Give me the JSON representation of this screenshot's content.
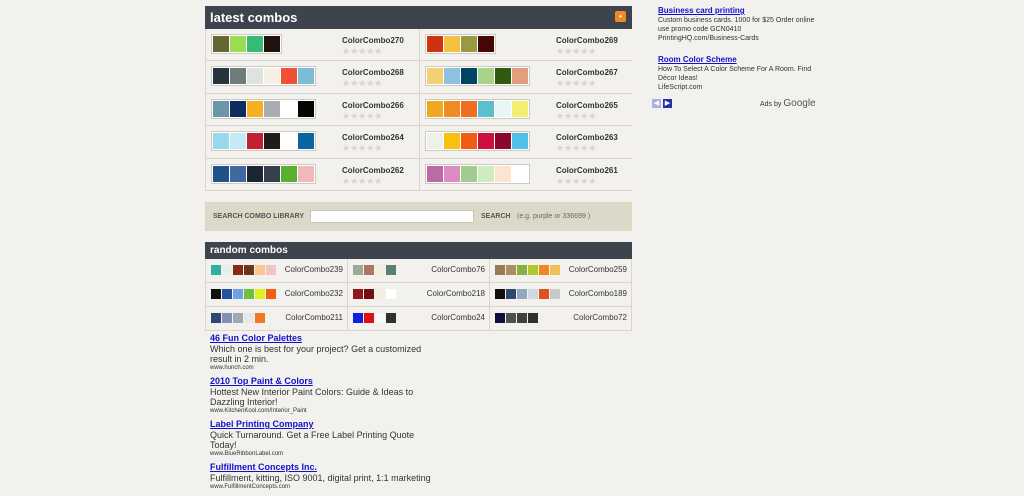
{
  "latest": {
    "title": "latest combos",
    "combos": [
      {
        "name": "ColorCombo270",
        "colors": [
          "#666633",
          "#99dd55",
          "#33bb77",
          "#221111"
        ]
      },
      {
        "name": "ColorCombo269",
        "colors": [
          "#cc3311",
          "#f5c040",
          "#999944",
          "#440808"
        ]
      },
      {
        "name": "ColorCombo268",
        "colors": [
          "#263440",
          "#6e7c7a",
          "#dde3de",
          "#f5f0e1",
          "#f05035",
          "#7bbcd6"
        ]
      },
      {
        "name": "ColorCombo267",
        "colors": [
          "#f5d070",
          "#8cc4e0",
          "#004466",
          "#a8d48a",
          "#2f5a0f",
          "#e0a080"
        ]
      },
      {
        "name": "ColorCombo266",
        "colors": [
          "#6a96a8",
          "#0d2c60",
          "#f5b020",
          "#a7adb2",
          "#ffffff",
          "#050505"
        ]
      },
      {
        "name": "ColorCombo265",
        "colors": [
          "#f0a820",
          "#f08a24",
          "#f06e20",
          "#5cc0cc",
          "#e8f6f6",
          "#f2ee70"
        ]
      },
      {
        "name": "ColorCombo264",
        "colors": [
          "#9ad8ee",
          "#c6eaf4",
          "#c02030",
          "#201c1c",
          "#ffffff",
          "#0a66a0"
        ]
      },
      {
        "name": "ColorCombo263",
        "colors": [
          "#eef0ea",
          "#f9c010",
          "#f05c14",
          "#d0103c",
          "#8a0830",
          "#52bfe8"
        ]
      },
      {
        "name": "ColorCombo262",
        "colors": [
          "#1e5288",
          "#3e6aa0",
          "#1d2630",
          "#344050",
          "#58b030",
          "#f0b8b8"
        ]
      },
      {
        "name": "ColorCombo261",
        "colors": [
          "#bb6aa6",
          "#dc8cc0",
          "#a0cc90",
          "#ceecc0",
          "#fce4d0",
          "#ffffff"
        ]
      }
    ]
  },
  "search": {
    "label": "SEARCH COMBO LIBRARY",
    "placeholder": "",
    "button": "SEARCH",
    "hint": "(e.g. purple or 336699 )"
  },
  "random": {
    "title": "random combos",
    "combos": [
      {
        "name": "ColorCombo239",
        "colors": [
          "#30b0a0",
          "#e4f0ee",
          "#8a2818",
          "#6a3818",
          "#f8c890",
          "#f0c4c4"
        ]
      },
      {
        "name": "ColorCombo76",
        "colors": [
          "#a0a898",
          "#a87860",
          "#f3eee0",
          "#5a8070"
        ]
      },
      {
        "name": "ColorCombo259",
        "colors": [
          "#9a7a50",
          "#a89060",
          "#88b040",
          "#b0c830",
          "#f08820",
          "#f0c060"
        ]
      },
      {
        "name": "ColorCombo232",
        "colors": [
          "#101010",
          "#2850a0",
          "#70a0e0",
          "#70c040",
          "#e0f020",
          "#f06010"
        ]
      },
      {
        "name": "ColorCombo218",
        "colors": [
          "#901818",
          "#701010",
          "#f3eee0",
          "#ffffff"
        ]
      },
      {
        "name": "ColorCombo189",
        "colors": [
          "#101010",
          "#304870",
          "#90a8c0",
          "#d0d8e0",
          "#e05020",
          "#c8c8c8"
        ]
      },
      {
        "name": "ColorCombo211",
        "colors": [
          "#304878",
          "#8090b0",
          "#a0a8b0",
          "#e8e8e8",
          "#f07820"
        ]
      },
      {
        "name": "ColorCombo24",
        "colors": [
          "#1020e0",
          "#e01010",
          "#f8f8f8",
          "#303030"
        ]
      },
      {
        "name": "ColorCombo72",
        "colors": [
          "#101040",
          "#505050",
          "#404040",
          "#303030"
        ]
      }
    ]
  },
  "ads_bottom": [
    {
      "title": "46 Fun Color Palettes",
      "desc": "Which one is best for your project? Get a customized result in 2 min.",
      "url": "www.hunch.com"
    },
    {
      "title": "2010 Top Paint & Colors",
      "desc": "Hottest New Interior Paint Colors: Guide & Ideas to Dazzling Interior!",
      "url": "www.KitchenKool.com/Interior_Paint"
    },
    {
      "title": "Label Printing Company",
      "desc": "Quick Turnaround. Get a Free Label Printing Quote Today!",
      "url": "www.BlueRibbonLabel.com"
    },
    {
      "title": "Fulfillment Concepts Inc.",
      "desc": "Fulfillment, kitting, ISO 9001, digital print, 1:1 marketing",
      "url": "www.FulfillmentConcepts.com"
    }
  ],
  "ads_right": [
    {
      "title": "Business card printing",
      "desc": "Custom business cards. 1000 for $25 Order online use promo code GCN0410",
      "url": "PrintingHQ.com/Business-Cards"
    },
    {
      "title": "Room Color Scheme",
      "desc": "How To Select A Color Scheme For A Room. Find Décor Ideas!",
      "url": "LifeScript.com"
    }
  ],
  "ads_by": {
    "prefix": "Ads by",
    "brand": "Google"
  },
  "icons": {
    "rss": "rss-icon",
    "prev": "arrow-left-icon",
    "next": "arrow-right-icon"
  }
}
